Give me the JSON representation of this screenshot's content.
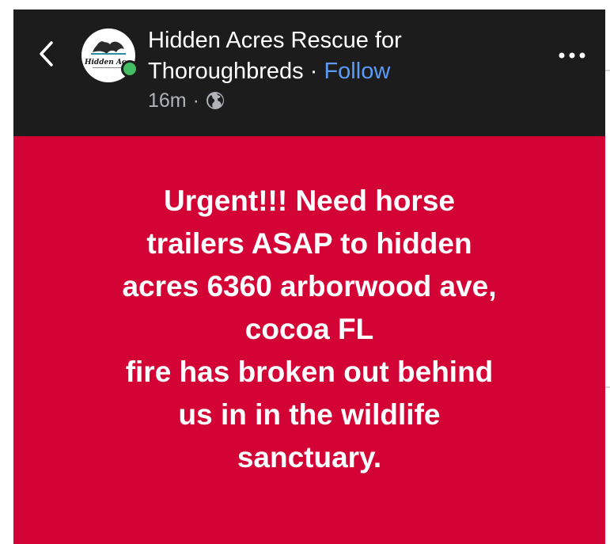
{
  "post": {
    "page_name": "Hidden Acres Rescue for Thoroughbreds",
    "separator": " · ",
    "follow_label": "Follow",
    "timestamp": "16m",
    "meta_separator": "·",
    "privacy_icon": "globe-icon",
    "avatar_text": "Hidden Ac",
    "body_text": "Urgent!!! Need horse\ntrailers ASAP to hidden\nacres 6360 arborwood ave,\ncocoa FL\nfire has broken out behind\nus in in the wildlife\nsanctuary.",
    "background_color": "#d30335"
  },
  "header": {
    "back_icon": "chevron-left-icon",
    "more_icon": "more-horizontal-icon"
  },
  "colors": {
    "header_bg": "#1c1c1c",
    "follow": "#5b9bf7",
    "online": "#45bd62"
  }
}
